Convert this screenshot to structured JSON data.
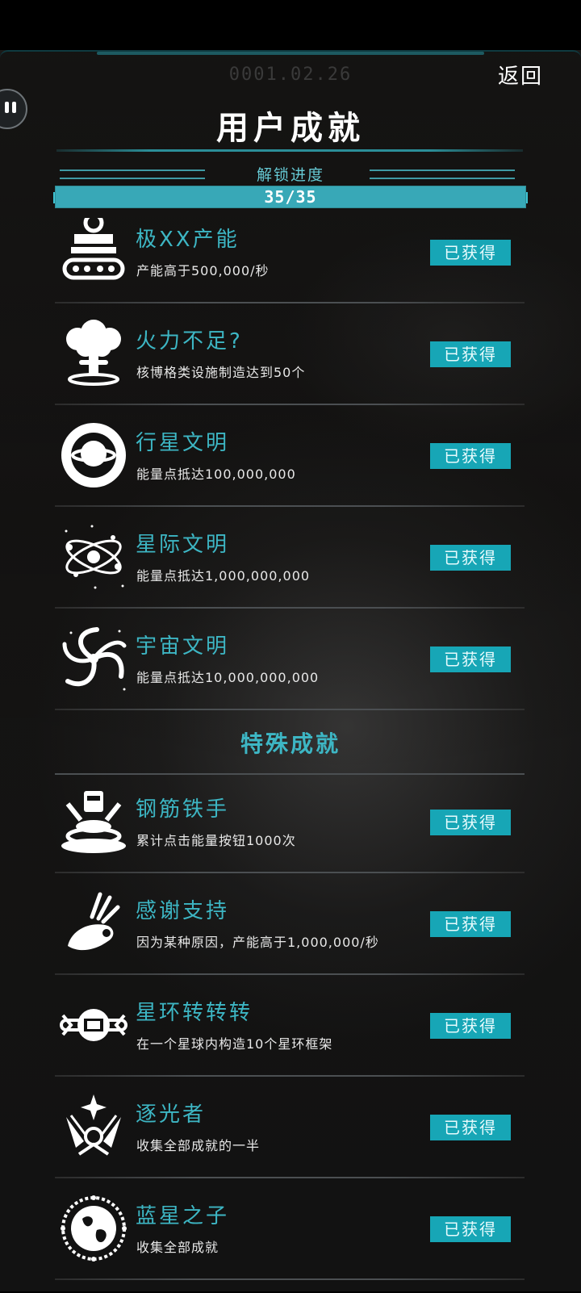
{
  "header": {
    "date": "0001.02.26",
    "back_label": "返回",
    "title": "用户成就"
  },
  "progress": {
    "label": "解锁进度",
    "text": "35/35",
    "fraction": 1.0
  },
  "colors": {
    "accent": "#3db6c4",
    "status_bg": "#17a6b6"
  },
  "achievements": [
    {
      "title": "极XX产能",
      "desc": "产能高于500,000/秒",
      "status": "已获得",
      "icon": "factory-conveyor-icon"
    },
    {
      "title": "火力不足?",
      "desc": "核博格类设施制造达到50个",
      "status": "已获得",
      "icon": "mushroom-cloud-icon"
    },
    {
      "title": "行星文明",
      "desc": "能量点抵达100,000,000",
      "status": "已获得",
      "icon": "planet-civilization-icon"
    },
    {
      "title": "星际文明",
      "desc": "能量点抵达1,000,000,000",
      "status": "已获得",
      "icon": "orbit-system-icon"
    },
    {
      "title": "宇宙文明",
      "desc": "能量点抵达10,000,000,000",
      "status": "已获得",
      "icon": "galaxy-spiral-icon"
    }
  ],
  "special_section": {
    "title": "特殊成就",
    "items": [
      {
        "title": "钢筋铁手",
        "desc": "累计点击能量按钮1000次",
        "status": "已获得",
        "icon": "press-button-icon"
      },
      {
        "title": "感谢支持",
        "desc": "因为某种原因，产能高于1,000,000/秒",
        "status": "已获得",
        "icon": "hand-gesture-icon"
      },
      {
        "title": "星环转转转",
        "desc": "在一个星球内构造10个星环框架",
        "status": "已获得",
        "icon": "ring-frame-icon"
      },
      {
        "title": "逐光者",
        "desc": "收集全部成就的一半",
        "status": "已获得",
        "icon": "light-chaser-emblem-icon"
      },
      {
        "title": "蓝星之子",
        "desc": "收集全部成就",
        "status": "已获得",
        "icon": "blue-planet-emblem-icon"
      }
    ]
  }
}
